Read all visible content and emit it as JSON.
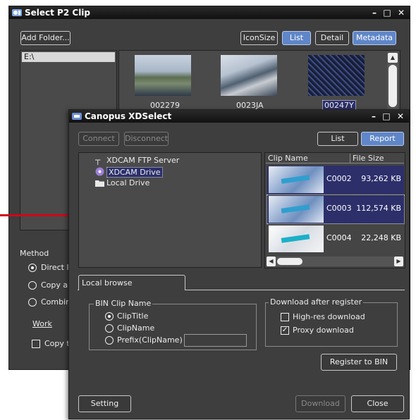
{
  "back_window": {
    "title": "Select P2 Clip",
    "add_folder_label": "Add Folder...",
    "buttons": {
      "icon_size": "IconSize",
      "list": "List",
      "detail": "Detail",
      "metadata": "Metadata"
    },
    "folder_path": "E:\\",
    "thumbnails": [
      {
        "label": "002279"
      },
      {
        "label": "0023JA"
      },
      {
        "label": "00247Y"
      }
    ],
    "method": {
      "label": "Method",
      "options": [
        {
          "label": "Direct In",
          "selected": true
        },
        {
          "label": "Copy ar",
          "selected": false
        },
        {
          "label": "Combine",
          "selected": false
        }
      ],
      "work_label": "Work",
      "copy_to_label": "Copy to"
    }
  },
  "front_window": {
    "title": "Canopus XDSelect",
    "toolbar": {
      "connect": "Connect",
      "disconnect": "Disconnect",
      "list": "List",
      "report": "Report"
    },
    "tree": [
      {
        "label": "XDCAM FTP Server",
        "icon": "ftp-server-icon"
      },
      {
        "label": "XDCAM Drive",
        "icon": "disc-drive-icon",
        "selected": true
      },
      {
        "label": "Local Drive",
        "icon": "folder-icon"
      }
    ],
    "clip_list": {
      "columns": [
        "Clip Name",
        "File Size"
      ],
      "rows": [
        {
          "name": "C0002",
          "size": "93,262 KB"
        },
        {
          "name": "C0003",
          "size": "112,574 KB"
        },
        {
          "name": "C0004",
          "size": "22,248 KB"
        }
      ]
    },
    "tab": {
      "label": "Local browse"
    },
    "bin_clip_name": {
      "legend": "BIN Clip Name",
      "options": [
        {
          "label": "ClipTitle",
          "selected": true
        },
        {
          "label": "ClipName",
          "selected": false
        },
        {
          "label": "Prefix(ClipName)",
          "selected": false
        }
      ],
      "prefix_value": ""
    },
    "download_after_register": {
      "legend": "Download after register",
      "options": [
        {
          "label": "High-res download",
          "checked": false
        },
        {
          "label": "Proxy download",
          "checked": true
        }
      ]
    },
    "register_button": "Register to BIN",
    "setting_button": "Setting",
    "download_button": "Download",
    "close_button": "Close"
  },
  "colors": {
    "window_bg": "#3e3e3e",
    "accent_blue": "#5f86c8",
    "callout_red": "#d0021b",
    "list_selection": "#2c2f6a"
  }
}
